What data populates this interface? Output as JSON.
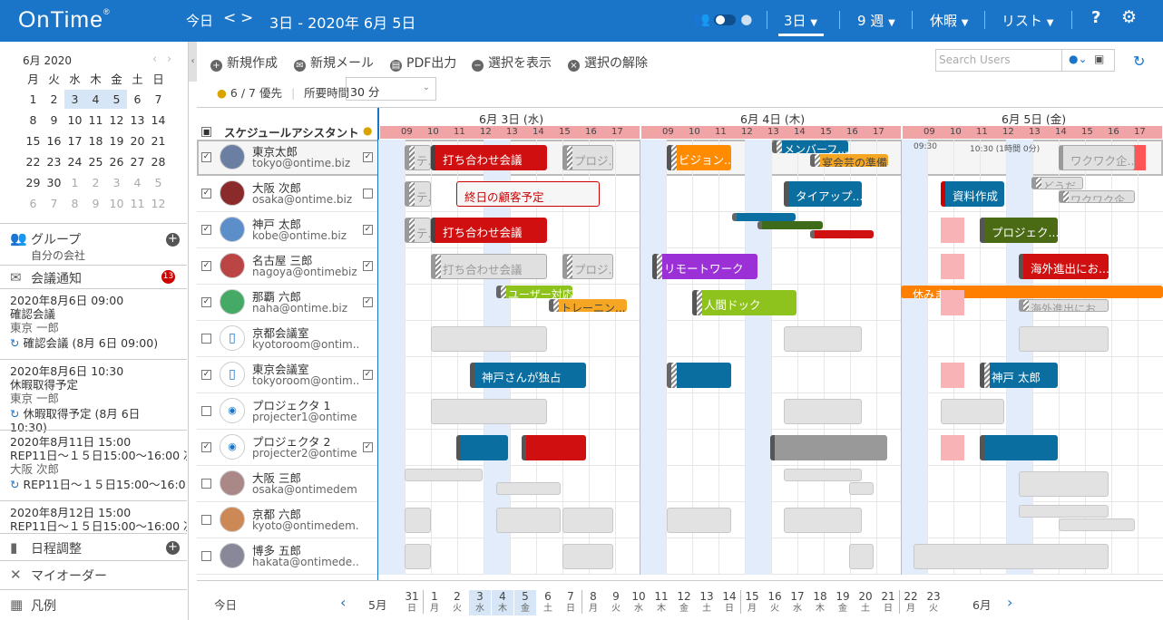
{
  "app": {
    "logo": "OnTime",
    "logo_mark": "®"
  },
  "topbar": {
    "today": "今日",
    "prev": "<",
    "next": ">",
    "range": "3日 - 2020年 6月 5日",
    "view_3d": "3日",
    "view_9w": "9 週",
    "vacation": "休暇",
    "list": "リスト",
    "help": "?",
    "settings": "gear-icon"
  },
  "minical": {
    "month": "6月 2020",
    "weekdays": [
      "月",
      "火",
      "水",
      "木",
      "金",
      "土",
      "日"
    ],
    "weeks": [
      [
        "1",
        "2",
        "3",
        "4",
        "5",
        "6",
        "7"
      ],
      [
        "8",
        "9",
        "10",
        "11",
        "12",
        "13",
        "14"
      ],
      [
        "15",
        "16",
        "17",
        "18",
        "19",
        "20",
        "21"
      ],
      [
        "22",
        "23",
        "24",
        "25",
        "26",
        "27",
        "28"
      ],
      [
        "29",
        "30",
        "1",
        "2",
        "3",
        "4",
        "5"
      ],
      [
        "6",
        "7",
        "8",
        "9",
        "10",
        "11",
        "12"
      ]
    ]
  },
  "sidebar": {
    "group_title": "グループ",
    "group_sub": "自分の会社",
    "notices_title": "会議通知",
    "notices_count": "13",
    "notices": [
      {
        "time": "2020年8月6日 09:00",
        "title": "確認会議",
        "who": "東京 一郎",
        "rep": "確認会議 (8月 6日 09:00)"
      },
      {
        "time": "2020年8月6日 10:30",
        "title": "休暇取得予定",
        "who": "東京 一郎",
        "rep": "休暇取得予定 (8月 6日 10:30)"
      },
      {
        "time": "2020年8月11日 15:00",
        "title": "REP11日～１５日15:00～16:00 次",
        "who": "大阪 次郎",
        "rep": "REP11日～１５日15:00～16:0..."
      },
      {
        "time": "2020年8月12日 15:00",
        "title": "REP11日～１５日15:00～16:00 次",
        "who": "",
        "rep": ""
      }
    ],
    "schedule": "日程調整",
    "myorder": "マイオーダー",
    "legend": "凡例"
  },
  "toolbar": {
    "new": "新規作成",
    "mail": "新規メール",
    "pdf": "PDF出力",
    "show": "選択を表示",
    "clear": "選択の解除",
    "search_placeholder": "Search Users",
    "priority": "6 / 7 優先",
    "duration_label": "所要時間",
    "duration_value": "30 分"
  },
  "grid": {
    "col_title": "スケジュールアシスタント",
    "days": [
      "6月 3日 (水)",
      "6月 4日 (木)",
      "6月 5日 (金)"
    ],
    "hours": [
      "09",
      "10",
      "11",
      "12",
      "13",
      "14",
      "15",
      "16",
      "17"
    ],
    "selected_slot": "09:30",
    "selected_slot2": "10:30 (1時間 0分)",
    "rows": [
      {
        "name": "東京太郎",
        "email": "tokyo@ontime.biz",
        "checked": true,
        "checked2": true
      },
      {
        "name": "大阪 次郎",
        "email": "osaka@ontime.biz",
        "checked": true,
        "checked2": false
      },
      {
        "name": "神戸 太郎",
        "email": "kobe@ontime.biz",
        "checked": true,
        "checked2": true
      },
      {
        "name": "名古屋 三郎",
        "email": "nagoya@ontimebiz...",
        "checked": true,
        "checked2": true
      },
      {
        "name": "那覇 六郎",
        "email": "naha@ontime.biz",
        "checked": true,
        "checked2": true
      },
      {
        "name": "京都会議室",
        "email": "kyotoroom@ontim...",
        "checked": false,
        "checked2": false
      },
      {
        "name": "東京会議室",
        "email": "tokyoroom@ontim...",
        "checked": true,
        "checked2": true
      },
      {
        "name": "プロジェクタ 1",
        "email": "projecter1@ontime...",
        "checked": false,
        "checked2": false
      },
      {
        "name": "プロジェクタ 2",
        "email": "projecter2@ontime...",
        "checked": true,
        "checked2": true
      },
      {
        "name": "大阪 三郎",
        "email": "osaka@ontimedem...",
        "checked": false,
        "checked2": false
      },
      {
        "name": "京都 六郎",
        "email": "kyoto@ontimedem...",
        "checked": false,
        "checked2": false
      },
      {
        "name": "博多 五郎",
        "email": "hakata@ontimede...",
        "checked": false,
        "checked2": false
      }
    ],
    "events": {
      "e1": "テ...",
      "e2": "打ち合わせ会議",
      "e3": "プロジ...",
      "e4": "ビジョン...",
      "e5": "メンバーフ...",
      "e6": "宴会芸の準備",
      "e7": "ワクワク企...",
      "e8": "テ...",
      "e9": "終日の顧客予定",
      "e10": "タイアップ...",
      "e11": "資料作成",
      "e12": "どうだ...",
      "e13": "ワクワク企...",
      "e14": "テ...",
      "e15": "打ち合わせ会議",
      "e16": "プロジェク...",
      "e17": "打ち合わせ会議",
      "e18": "プロジ...",
      "e19": "リモートワーク",
      "e20": "海外進出にお...",
      "e21": "ユーザー対応",
      "e22": "トレーニン...",
      "e23": "人間ドック",
      "e24": "休みます",
      "e25": "海外進出にお...",
      "e26": "神戸さんが独占",
      "e27": "神戸 太郎"
    }
  },
  "bottombar": {
    "today": "今日",
    "prev_month": "5月",
    "next_month": "6月",
    "dates": [
      [
        "31",
        "日"
      ],
      [
        "1",
        "月"
      ],
      [
        "2",
        "火"
      ],
      [
        "3",
        "水"
      ],
      [
        "4",
        "木"
      ],
      [
        "5",
        "金"
      ],
      [
        "6",
        "土"
      ],
      [
        "7",
        "日"
      ],
      [
        "8",
        "月"
      ],
      [
        "9",
        "火"
      ],
      [
        "10",
        "水"
      ],
      [
        "11",
        "木"
      ],
      [
        "12",
        "金"
      ],
      [
        "13",
        "土"
      ],
      [
        "14",
        "日"
      ],
      [
        "15",
        "月"
      ],
      [
        "16",
        "火"
      ],
      [
        "17",
        "水"
      ],
      [
        "18",
        "木"
      ],
      [
        "19",
        "金"
      ],
      [
        "20",
        "土"
      ],
      [
        "21",
        "日"
      ],
      [
        "22",
        "月"
      ],
      [
        "23",
        "火"
      ]
    ]
  }
}
